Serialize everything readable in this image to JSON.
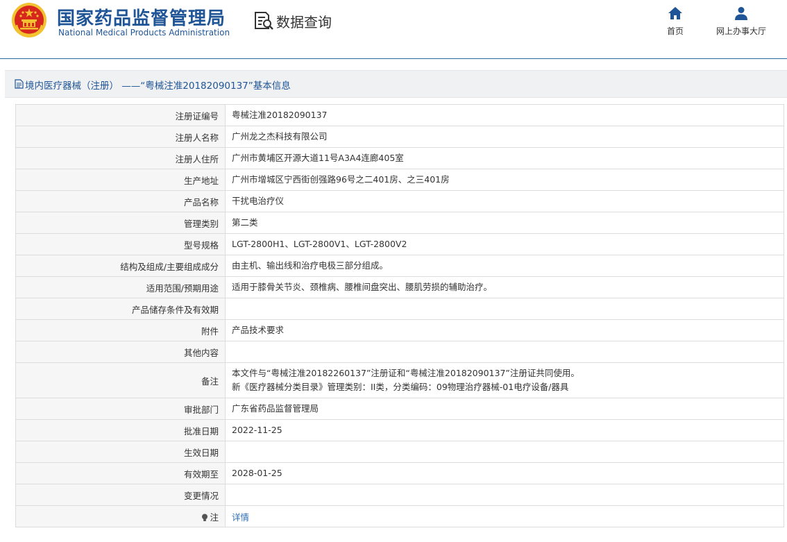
{
  "header": {
    "org_name_cn": "国家药品监督管理局",
    "org_name_en": "National Medical Products Administration",
    "page_title": "数据查询",
    "nav": [
      {
        "label": "首页",
        "icon": "home-icon"
      },
      {
        "label": "网上办事大厅",
        "icon": "user-icon"
      }
    ]
  },
  "section": {
    "title": "境内医疗器械（注册） ——“粤械注准20182090137”基本信息",
    "icon": "document-icon"
  },
  "details": [
    {
      "label": "注册证编号",
      "value": [
        "粤械注准20182090137"
      ]
    },
    {
      "label": "注册人名称",
      "value": [
        "广州龙之杰科技有限公司"
      ]
    },
    {
      "label": "注册人住所",
      "value": [
        "广州市黄埔区开源大道11号A3A4连廊405室"
      ]
    },
    {
      "label": "生产地址",
      "value": [
        "广州市增城区宁西街创强路96号之二401房、之三401房"
      ]
    },
    {
      "label": "产品名称",
      "value": [
        "干扰电治疗仪"
      ]
    },
    {
      "label": "管理类别",
      "value": [
        "第二类"
      ]
    },
    {
      "label": "型号规格",
      "value": [
        "LGT-2800H1、LGT-2800V1、LGT-2800V2"
      ]
    },
    {
      "label": "结构及组成/主要组成成分",
      "value": [
        "由主机、输出线和治疗电极三部分组成。"
      ]
    },
    {
      "label": "适用范围/预期用途",
      "value": [
        "适用于膝骨关节炎、颈椎病、腰椎间盘突出、腰肌劳损的辅助治疗。"
      ]
    },
    {
      "label": "产品储存条件及有效期",
      "value": []
    },
    {
      "label": "附件",
      "value": [
        "产品技术要求"
      ]
    },
    {
      "label": "其他内容",
      "value": []
    },
    {
      "label": "备注",
      "value": [
        "本文件与“粤械注准20182260137”注册证和“粤械注准20182090137”注册证共同使用。",
        "新《医疗器械分类目录》管理类别：II类，分类编码：09物理治疗器械-01电疗设备/器具"
      ]
    },
    {
      "label": "审批部门",
      "value": [
        "广东省药品监督管理局"
      ]
    },
    {
      "label": "批准日期",
      "value": [
        "2022-11-25"
      ]
    },
    {
      "label": "生效日期",
      "value": []
    },
    {
      "label": "有效期至",
      "value": [
        "2028-01-25"
      ]
    },
    {
      "label": "变更情况",
      "value": []
    }
  ],
  "note_row": {
    "label": "注",
    "link": "详情",
    "icon": "lightbulb-icon"
  },
  "colors": {
    "brand": "#1f5596",
    "link": "#2f6fb5",
    "emblem_red": "#d7261e",
    "emblem_gold": "#f2c230"
  }
}
